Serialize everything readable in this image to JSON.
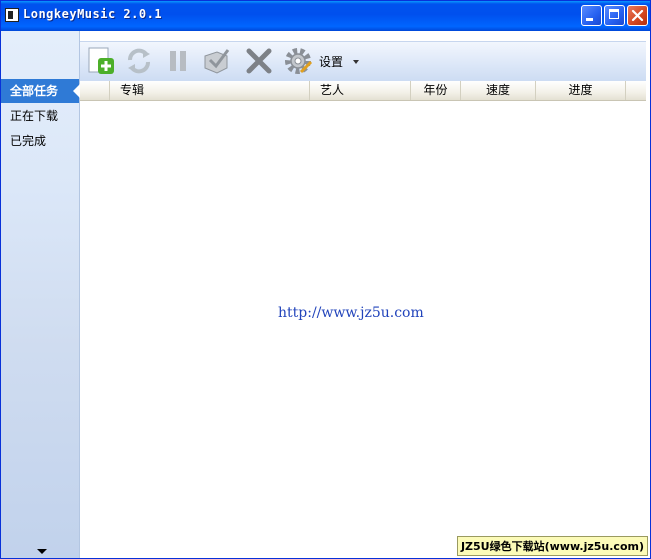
{
  "window": {
    "title": "LongkeyMusic 2.0.1",
    "accent": "#0053ee"
  },
  "sidebar": {
    "items": [
      {
        "label": "全部任务",
        "active": true
      },
      {
        "label": "正在下载",
        "active": false
      },
      {
        "label": "已完成",
        "active": false
      }
    ],
    "scroll_icon": "chevron-down-icon"
  },
  "toolbar": {
    "add_icon": "add-plus-icon",
    "refresh_icon": "refresh-icon",
    "pause_icon": "pause-icon",
    "open_icon": "folder-check-icon",
    "delete_icon": "delete-x-icon",
    "settings_icon": "gear-icon",
    "settings_label": "设置"
  },
  "table": {
    "columns": [
      "",
      "专辑",
      "艺人",
      "年份",
      "速度",
      "进度"
    ],
    "rows": []
  },
  "watermark": "http://www.jz5u.com",
  "badge": "JZ5U绿色下载站(www.jz5u.com)"
}
